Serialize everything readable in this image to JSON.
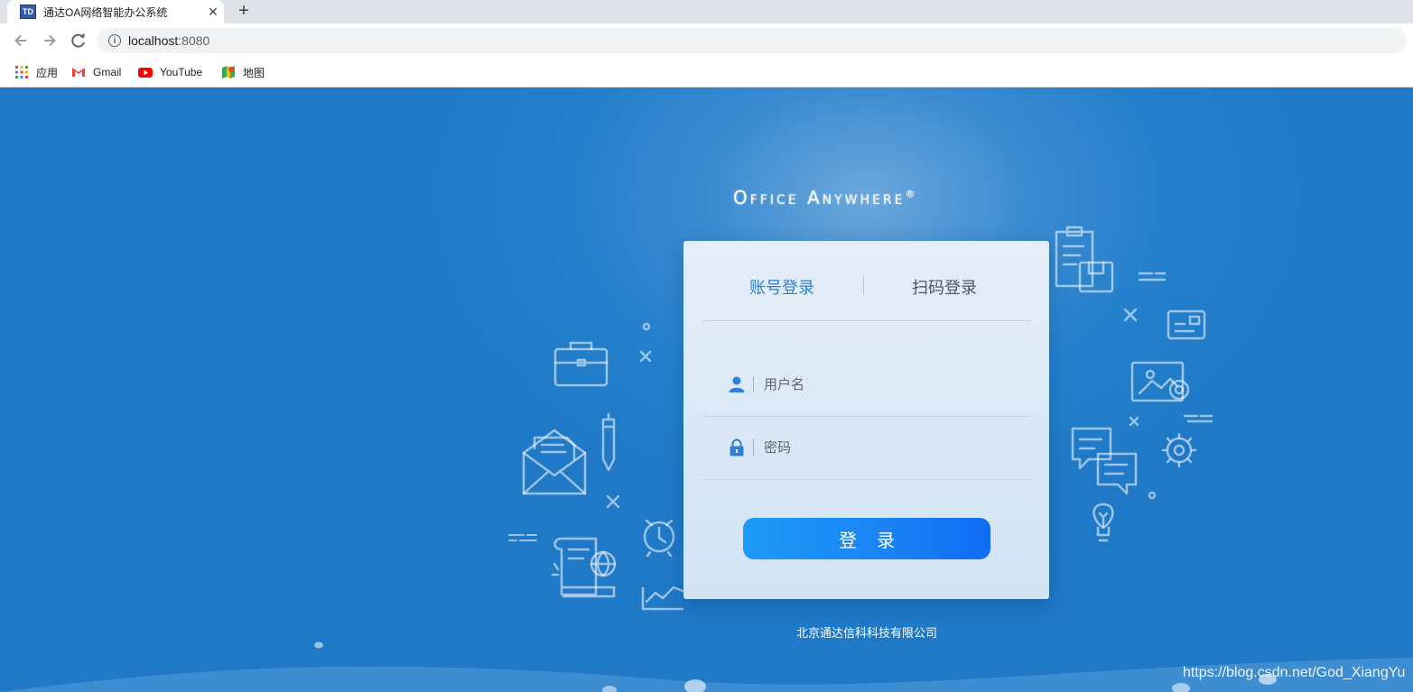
{
  "browser": {
    "tab": {
      "favicon_text": "TD",
      "title": "通达OA网络智能办公系统",
      "close_glyph": "✕"
    },
    "new_tab_glyph": "+",
    "address": {
      "host": "localhost",
      "port": ":8080"
    },
    "bookmarks": [
      {
        "label": "应用",
        "icon": "apps-grid-icon"
      },
      {
        "label": "Gmail",
        "icon": "gmail-icon"
      },
      {
        "label": "YouTube",
        "icon": "youtube-icon"
      },
      {
        "label": "地图",
        "icon": "maps-icon"
      }
    ]
  },
  "login": {
    "logo_text": "Office Anywhere",
    "logo_mark": "®",
    "tabs": [
      {
        "label": "账号登录",
        "active": true
      },
      {
        "label": "扫码登录",
        "active": false
      }
    ],
    "username_placeholder": "用户名",
    "password_placeholder": "密码",
    "submit_label": "登录",
    "company": "北京通达信科科技有限公司",
    "accent_color": "#2f80d6",
    "button_color": "#1a84f5",
    "background_color": "#2480cc"
  },
  "watermark": "https://blog.csdn.net/God_XiangYu"
}
